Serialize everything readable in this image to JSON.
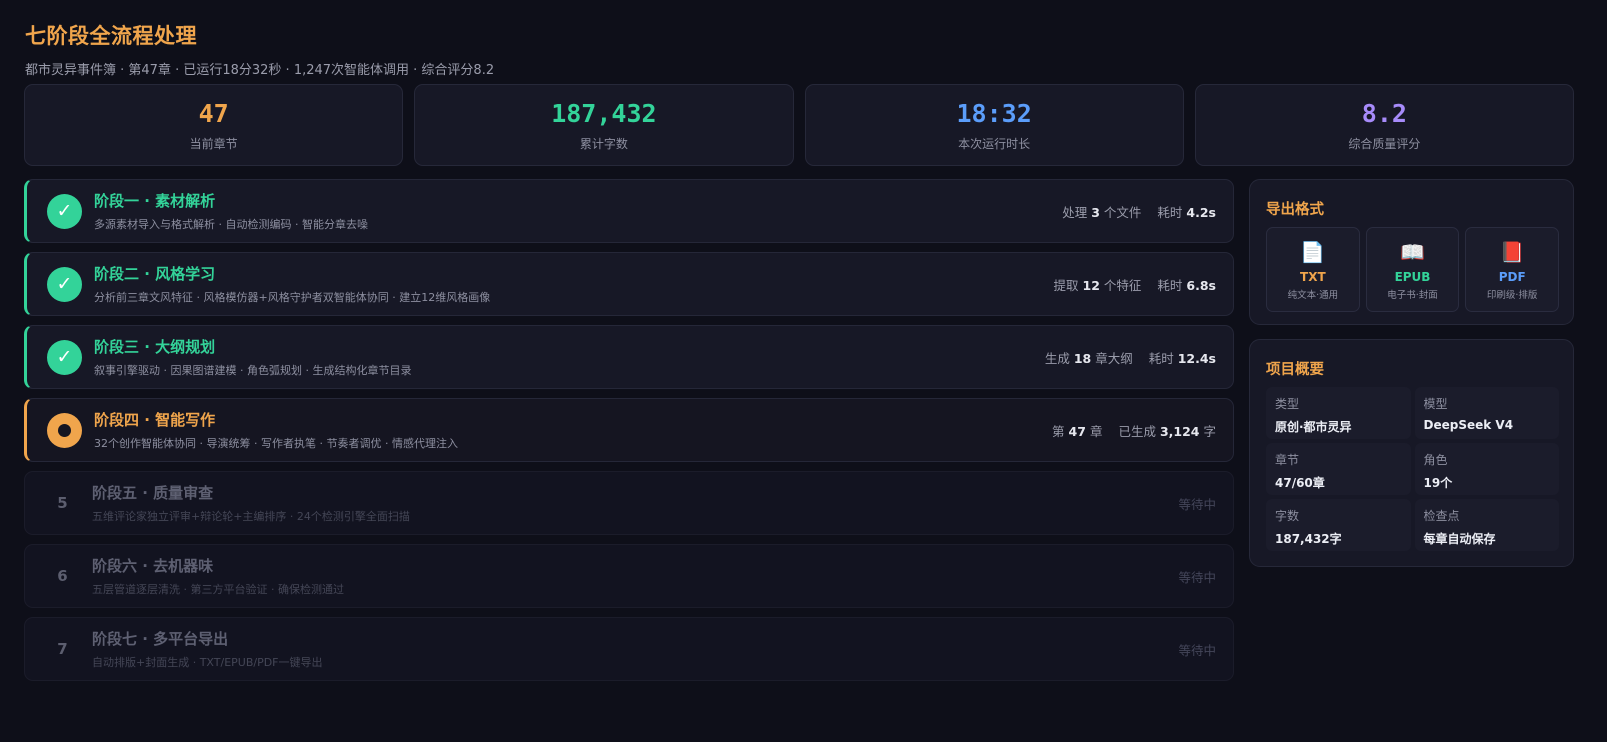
{
  "header": {
    "title": "七阶段全流程处理",
    "subtitle": "都市灵异事件簿 · 第47章 · 已运行18分32秒 · 1,247次智能体调用 · 综合评分8.2"
  },
  "stats": [
    {
      "value": "47",
      "label": "当前章节",
      "color": "#f0a54c"
    },
    {
      "value": "187,432",
      "label": "累计字数",
      "color": "#33d399"
    },
    {
      "value": "18:32",
      "label": "本次运行时长",
      "color": "#5b9dfa"
    },
    {
      "value": "8.2",
      "label": "综合质量评分",
      "color": "#a78bfa"
    }
  ],
  "stages": [
    {
      "status": "done",
      "badge": "✓",
      "title": "阶段一 · 素材解析",
      "desc": "多源素材导入与格式解析 · 自动检测编码 · 智能分章去噪",
      "meta": [
        {
          "pre": "处理",
          "val": "3",
          "post": "个文件"
        },
        {
          "pre": "耗时",
          "val": "4.2s",
          "post": ""
        }
      ]
    },
    {
      "status": "done",
      "badge": "✓",
      "title": "阶段二 · 风格学习",
      "desc": "分析前三章文风特征 · 风格模仿器+风格守护者双智能体协同 · 建立12维风格画像",
      "meta": [
        {
          "pre": "提取",
          "val": "12",
          "post": "个特征"
        },
        {
          "pre": "耗时",
          "val": "6.8s",
          "post": ""
        }
      ]
    },
    {
      "status": "done",
      "badge": "✓",
      "title": "阶段三 · 大纲规划",
      "desc": "叙事引擎驱动 · 因果图谱建模 · 角色弧规划 · 生成结构化章节目录",
      "meta": [
        {
          "pre": "生成",
          "val": "18",
          "post": "章大纲"
        },
        {
          "pre": "耗时",
          "val": "12.4s",
          "post": ""
        }
      ]
    },
    {
      "status": "active",
      "badge": "",
      "title": "阶段四 · 智能写作",
      "desc": "32个创作智能体协同 · 导演统筹 · 写作者执笔 · 节奏者调优 · 情感代理注入",
      "meta": [
        {
          "pre": "第",
          "val": "47",
          "post": "章"
        },
        {
          "pre": "已生成",
          "val": "3,124",
          "post": "字"
        }
      ]
    },
    {
      "status": "pending",
      "badge": "5",
      "title": "阶段五 · 质量审查",
      "desc": "五维评论家独立评审+辩论轮+主编排序 · 24个检测引擎全面扫描",
      "meta": [
        {
          "pre": "等待中",
          "val": "",
          "post": ""
        }
      ]
    },
    {
      "status": "pending",
      "badge": "6",
      "title": "阶段六 · 去机器味",
      "desc": "五层管道逐层清洗 · 第三方平台验证 · 确保检测通过",
      "meta": [
        {
          "pre": "等待中",
          "val": "",
          "post": ""
        }
      ]
    },
    {
      "status": "pending",
      "badge": "7",
      "title": "阶段七 · 多平台导出",
      "desc": "自动排版+封面生成 · TXT/EPUB/PDF一键导出",
      "meta": [
        {
          "pre": "等待中",
          "val": "",
          "post": ""
        }
      ]
    }
  ],
  "export": {
    "title": "导出格式",
    "formats": [
      {
        "icon": "📄",
        "icon_name": "txt-file-icon",
        "name": "TXT",
        "desc": "纯文本·通用",
        "color": "#f0a54c"
      },
      {
        "icon": "📖",
        "icon_name": "epub-book-icon",
        "name": "EPUB",
        "desc": "电子书·封面",
        "color": "#33d399"
      },
      {
        "icon": "📕",
        "icon_name": "pdf-book-icon",
        "name": "PDF",
        "desc": "印刷级·排版",
        "color": "#5b9dfa"
      }
    ]
  },
  "overview": {
    "title": "项目概要",
    "items": [
      {
        "label": "类型",
        "value": "原创·都市灵异"
      },
      {
        "label": "模型",
        "value": "DeepSeek V4"
      },
      {
        "label": "章节",
        "value": "47/60章"
      },
      {
        "label": "角色",
        "value": "19个"
      },
      {
        "label": "字数",
        "value": "187,432字"
      },
      {
        "label": "检查点",
        "value": "每章自动保存"
      }
    ]
  }
}
